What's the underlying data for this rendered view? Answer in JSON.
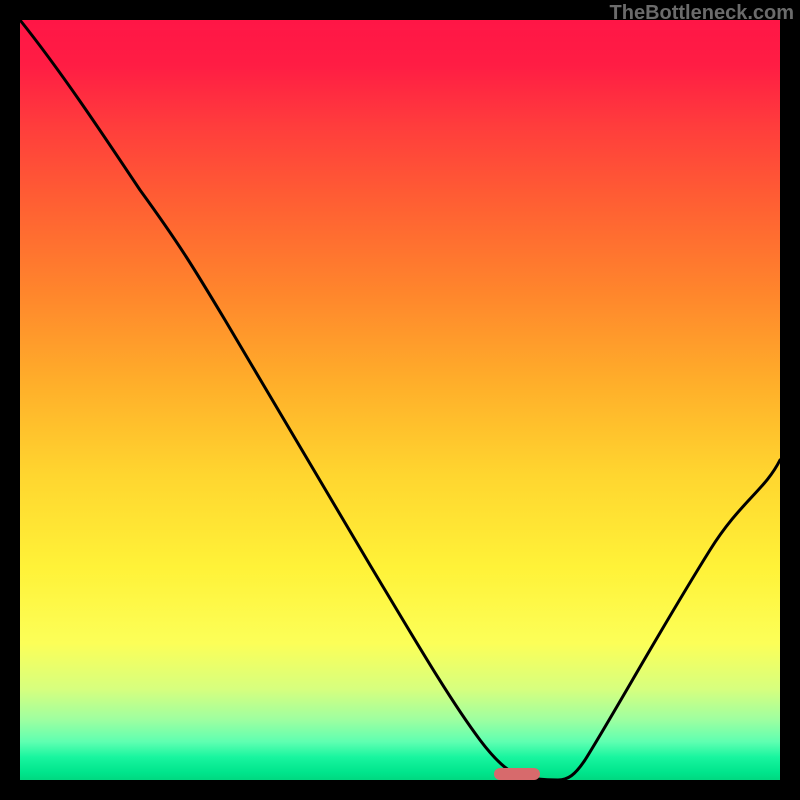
{
  "watermark": {
    "text": "TheBottleneck.com"
  },
  "colors": {
    "page_bg": "#000000",
    "curve_stroke": "#000000",
    "pill": "#d76a6c",
    "watermark": "#6b6b6b",
    "gradient_stops": [
      "#ff1646",
      "#ff1d44",
      "#ff3d3c",
      "#ff5f33",
      "#ff862c",
      "#ffaf2a",
      "#ffd62f",
      "#fff238",
      "#fcff58",
      "#d7ff7e",
      "#9fffa0",
      "#5effb1",
      "#18f59f",
      "#00e58c",
      "#00d880"
    ]
  },
  "chart_data": {
    "type": "line",
    "title": "",
    "xlabel": "",
    "ylabel": "",
    "xlim": [
      0,
      100
    ],
    "ylim": [
      0,
      100
    ],
    "grid": false,
    "legend": false,
    "series": [
      {
        "name": "bottleneck-curve",
        "x": [
          0,
          8,
          15,
          22,
          30,
          38,
          46,
          54,
          60,
          63,
          66,
          69,
          72,
          78,
          86,
          94,
          100
        ],
        "y": [
          100,
          91,
          82,
          72,
          60,
          47,
          34,
          21,
          11,
          6,
          2,
          0,
          0,
          6,
          18,
          32,
          42
        ]
      }
    ],
    "marker": {
      "name": "optimum-pill",
      "x_range": [
        62,
        68
      ],
      "y": 0,
      "color": "#d76a6c"
    }
  }
}
